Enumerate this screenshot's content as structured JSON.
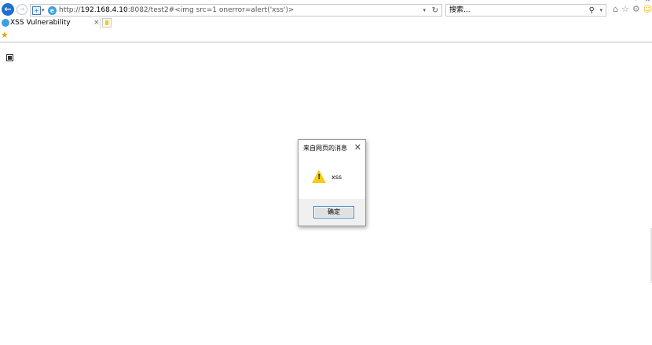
{
  "browser": {
    "url_prefix": "http://",
    "url_host": "192.168.4.10",
    "url_rest": ":8082/test2#<img src=1 onerror=alert('xss')>",
    "search_placeholder": "搜索...",
    "tab_title": "XSS Vulnerability",
    "tab_close_glyph": "×",
    "caption_minimize": "–",
    "caption_close": "×"
  },
  "icons": {
    "back": "back-arrow-icon",
    "forward": "forward-arrow-icon",
    "refresh": "refresh-icon",
    "search": "search-icon",
    "home": "home-icon",
    "favorites": "star-icon",
    "settings": "gear-icon",
    "smiley": "smiley-icon",
    "warning": "warning-icon",
    "broken_image": "broken-image-icon"
  },
  "dialog": {
    "title": "来自网页的消息",
    "message": "xss",
    "ok_label": "确定",
    "close_glyph": "✕"
  },
  "colors": {
    "accent": "#1f6fd1",
    "warning": "#f7cc1a",
    "button_border": "#3b7fd1"
  }
}
